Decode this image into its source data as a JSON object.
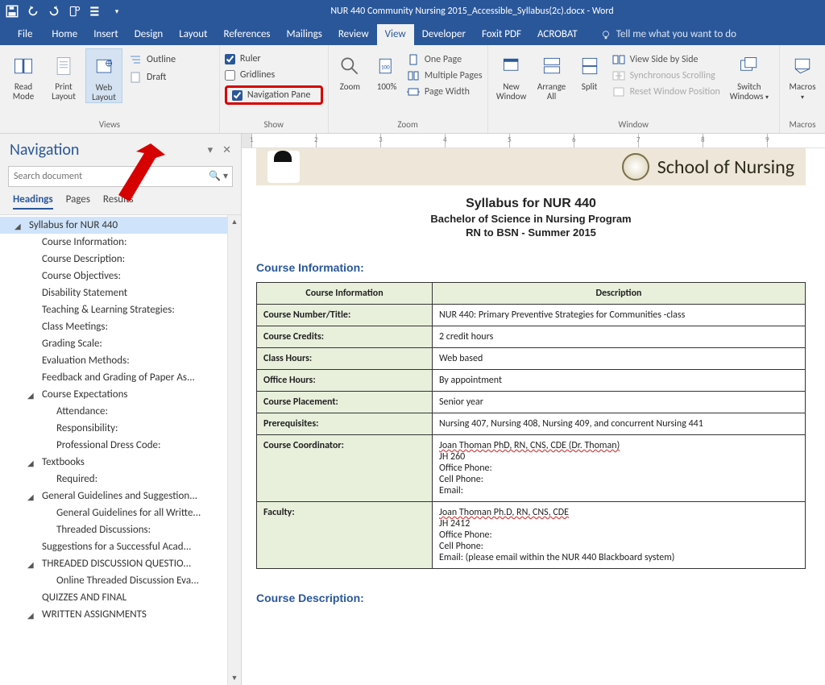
{
  "titlebar": {
    "title": "NUR 440 Community Nursing 2015_Accessible_Syllabus(2c).docx - Word"
  },
  "tabs": {
    "file": "File",
    "home": "Home",
    "insert": "Insert",
    "design": "Design",
    "layout": "Layout",
    "references": "References",
    "mailings": "Mailings",
    "review": "Review",
    "view": "View",
    "developer": "Developer",
    "foxit": "Foxit PDF",
    "acrobat": "ACROBAT",
    "tellme": "Tell me what you want to do"
  },
  "ribbon": {
    "views": {
      "read": "Read Mode",
      "print": "Print Layout",
      "web": "Web Layout",
      "outline": "Outline",
      "draft": "Draft",
      "group": "Views"
    },
    "show": {
      "ruler": "Ruler",
      "gridlines": "Gridlines",
      "navpane": "Navigation Pane",
      "group": "Show"
    },
    "zoom": {
      "zoom": "Zoom",
      "hundred": "100%",
      "onepage": "One Page",
      "multi": "Multiple Pages",
      "pagewidth": "Page Width",
      "group": "Zoom"
    },
    "window": {
      "new": "New Window",
      "arrange": "Arrange All",
      "split": "Split",
      "side": "View Side by Side",
      "sync": "Synchronous Scrolling",
      "reset": "Reset Window Position",
      "switch": "Switch Windows",
      "group": "Window"
    },
    "macros": {
      "macros": "Macros",
      "group": "Macros"
    }
  },
  "nav": {
    "title": "Navigation",
    "search_ph": "Search document",
    "tabs": {
      "headings": "Headings",
      "pages": "Pages",
      "results": "Results"
    },
    "items": [
      {
        "lvl": 1,
        "tri": true,
        "sel": true,
        "label": "Syllabus for NUR 440"
      },
      {
        "lvl": 2,
        "label": "Course Information:"
      },
      {
        "lvl": 2,
        "label": "Course Description:"
      },
      {
        "lvl": 2,
        "label": "Course Objectives:"
      },
      {
        "lvl": 2,
        "label": "Disability Statement"
      },
      {
        "lvl": 2,
        "label": "Teaching & Learning Strategies:"
      },
      {
        "lvl": 2,
        "label": "Class Meetings:"
      },
      {
        "lvl": 2,
        "label": "Grading Scale:"
      },
      {
        "lvl": 2,
        "label": "Evaluation Methods:"
      },
      {
        "lvl": 2,
        "label": "Feedback and Grading of Paper As..."
      },
      {
        "lvl": 2,
        "tri": true,
        "label": "Course Expectations"
      },
      {
        "lvl": 3,
        "label": "Attendance:"
      },
      {
        "lvl": 3,
        "label": "Responsibility:"
      },
      {
        "lvl": 3,
        "label": "Professional Dress Code:"
      },
      {
        "lvl": 2,
        "tri": true,
        "label": "Textbooks"
      },
      {
        "lvl": 3,
        "label": "Required:"
      },
      {
        "lvl": 2,
        "tri": true,
        "label": "General Guidelines and Suggestion..."
      },
      {
        "lvl": 3,
        "label": "General Guidelines for all Writte..."
      },
      {
        "lvl": 3,
        "label": "Threaded Discussions:"
      },
      {
        "lvl": 2,
        "label": "Suggestions for a Successful Acad..."
      },
      {
        "lvl": 2,
        "tri": true,
        "label": "THREADED DISCUSSION QUESTIO..."
      },
      {
        "lvl": 3,
        "label": "Online Threaded Discussion Eva..."
      },
      {
        "lvl": 2,
        "label": "QUIZZES AND FINAL"
      },
      {
        "lvl": 2,
        "tri": true,
        "label": "WRITTEN ASSIGNMENTS"
      }
    ]
  },
  "doc": {
    "banner": "School of Nursing",
    "h1": "Syllabus for NUR 440",
    "h2a": "Bachelor of Science in Nursing Program",
    "h2b": "RN to BSN  -  Summer 2015",
    "sect1": "Course Information:",
    "th1": "Course Information",
    "th2": "Description",
    "rows": [
      {
        "k": "Course Number/Title:",
        "v": "NUR 440: Primary Preventive Strategies for Communities -class"
      },
      {
        "k": "Course Credits:",
        "v": "2 credit hours"
      },
      {
        "k": "Class Hours:",
        "v": "Web based"
      },
      {
        "k": "Office Hours:",
        "v": "By appointment"
      },
      {
        "k": "Course Placement:",
        "v": "Senior year"
      },
      {
        "k": "Prerequisites:",
        "v": "Nursing 407, Nursing 408, Nursing 409, and concurrent Nursing 441"
      },
      {
        "k": "Course Coordinator:",
        "v": "Joan Thoman PhD, RN, CNS, CDE (Dr. Thoman)\nJH 260\nOffice Phone:\nCell Phone:\nEmail:"
      },
      {
        "k": "Faculty:",
        "v": "Joan Thoman Ph.D, RN, CNS, CDE\nJH 2412\nOffice Phone:\nCell Phone:\nEmail:                                      (please email within the NUR 440 Blackboard system)"
      }
    ],
    "sect2": "Course Description:"
  },
  "ruler": {
    "marks": [
      "1",
      "2",
      "3",
      "4",
      "5",
      "6",
      "7",
      "8",
      "9"
    ]
  }
}
